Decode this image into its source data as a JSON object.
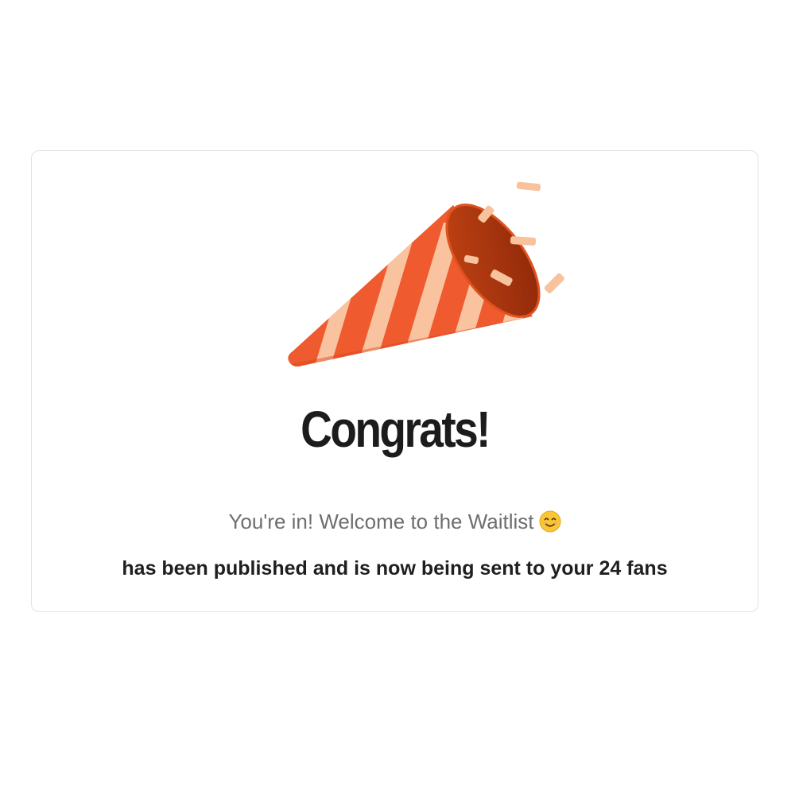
{
  "card": {
    "title": "Congrats!",
    "subtitle": "You're in! Welcome to the Waitlist",
    "subtitle_emoji": "smiling-face-emoji",
    "message": "has been published and is now being sent to your 24 fans"
  },
  "illustration": {
    "icon": "party-popper-icon"
  },
  "colors": {
    "cone_orange": "#ef5a2e",
    "cone_stripe": "#f9c3a0",
    "confetti": "#f7c29c",
    "title_text": "#1c1c1c",
    "subtitle_text": "#6e6e6e",
    "message_text": "#1f1f1f",
    "card_border": "#e3e3e3"
  }
}
